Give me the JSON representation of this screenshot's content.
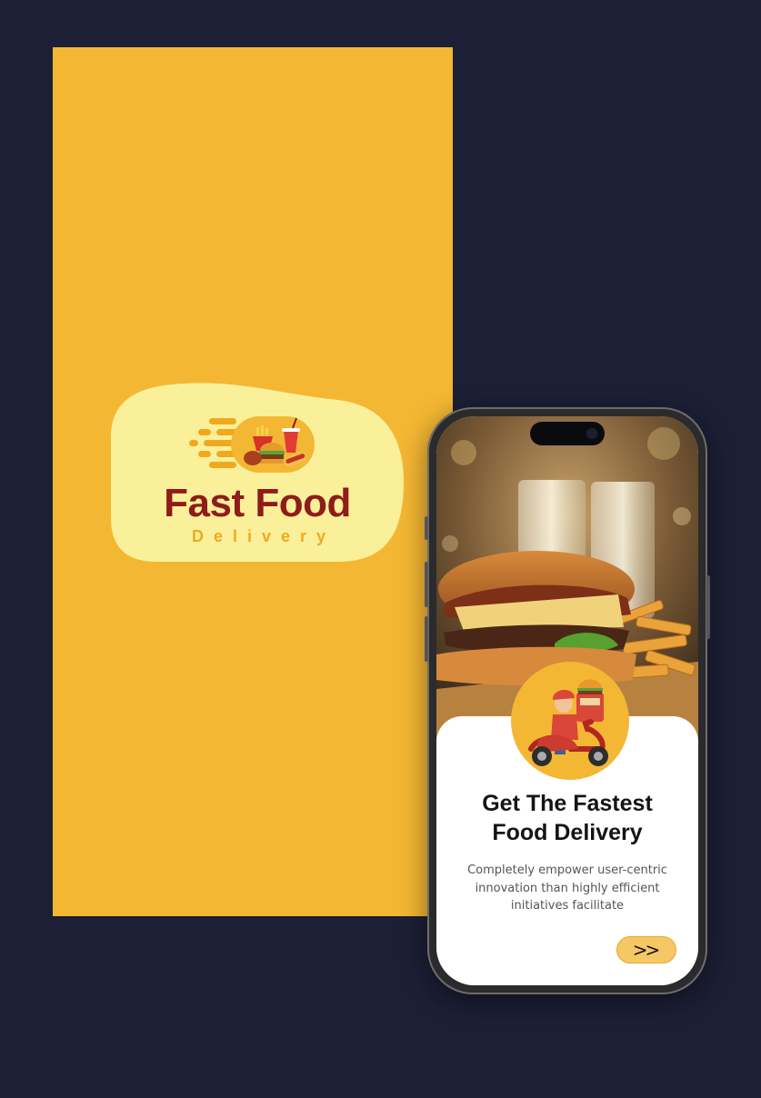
{
  "splash": {
    "logo_title": "Fast Food",
    "logo_subtitle": "Delivery"
  },
  "onboarding": {
    "headline_line1": "Get The Fastest",
    "headline_line2": "Food Delivery",
    "body_line1": "Completely empower user-centric",
    "body_line2": "innovation than highly efficient",
    "body_line3": "initiatives facilitate",
    "next_button_label": ">>",
    "next_button_icon": "double-chevron-right-icon"
  },
  "colors": {
    "page_background": "#1c1f36",
    "brand_yellow": "#f4b733",
    "logo_blob": "#fbf09a",
    "brand_red": "#8e1c1b",
    "button_fill": "#f6c765"
  }
}
